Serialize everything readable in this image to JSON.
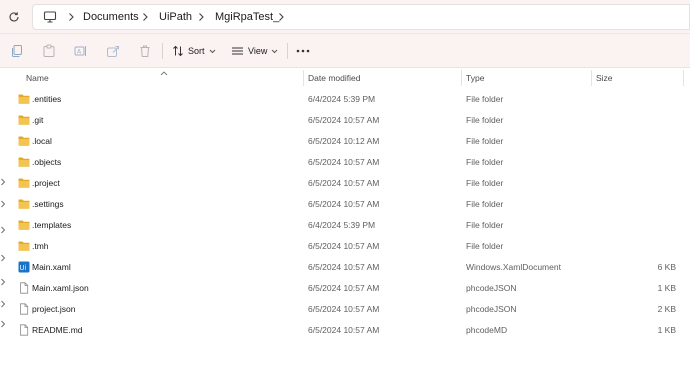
{
  "address": {
    "crumbs": [
      "Documents",
      "UiPath",
      "MgiRpaTest_"
    ]
  },
  "toolbar": {
    "sort_label": "Sort",
    "view_label": "View"
  },
  "columns": {
    "name": "Name",
    "date": "Date modified",
    "type": "Type",
    "size": "Size"
  },
  "files": [
    {
      "name": ".entities",
      "date": "6/4/2024 5:39 PM",
      "type": "File folder",
      "size": "",
      "icon": "folder-icon"
    },
    {
      "name": ".git",
      "date": "6/5/2024 10:57 AM",
      "type": "File folder",
      "size": "",
      "icon": "folder-icon"
    },
    {
      "name": ".local",
      "date": "6/5/2024 10:12 AM",
      "type": "File folder",
      "size": "",
      "icon": "folder-icon"
    },
    {
      "name": ".objects",
      "date": "6/5/2024 10:57 AM",
      "type": "File folder",
      "size": "",
      "icon": "folder-icon"
    },
    {
      "name": ".project",
      "date": "6/5/2024 10:57 AM",
      "type": "File folder",
      "size": "",
      "icon": "folder-icon"
    },
    {
      "name": ".settings",
      "date": "6/5/2024 10:57 AM",
      "type": "File folder",
      "size": "",
      "icon": "folder-icon"
    },
    {
      "name": ".templates",
      "date": "6/4/2024 5:39 PM",
      "type": "File folder",
      "size": "",
      "icon": "folder-icon"
    },
    {
      "name": ".tmh",
      "date": "6/5/2024 10:57 AM",
      "type": "File folder",
      "size": "",
      "icon": "folder-icon"
    },
    {
      "name": "Main.xaml",
      "date": "6/5/2024 10:57 AM",
      "type": "Windows.XamlDocument",
      "size": "6 KB",
      "icon": "uipath-xaml-icon"
    },
    {
      "name": "Main.xaml.json",
      "date": "6/5/2024 10:57 AM",
      "type": "phcodeJSON",
      "size": "1 KB",
      "icon": "file-icon"
    },
    {
      "name": "project.json",
      "date": "6/5/2024 10:57 AM",
      "type": "phcodeJSON",
      "size": "2 KB",
      "icon": "file-icon"
    },
    {
      "name": "README.md",
      "date": "6/5/2024 10:57 AM",
      "type": "phcodeMD",
      "size": "1 KB",
      "icon": "file-icon"
    }
  ],
  "colors": {
    "chrome_bg": "#fbf3f2",
    "folder": "#f3c44f",
    "folder_dark": "#e2a92b",
    "uipath_blue": "#1a73c9"
  }
}
